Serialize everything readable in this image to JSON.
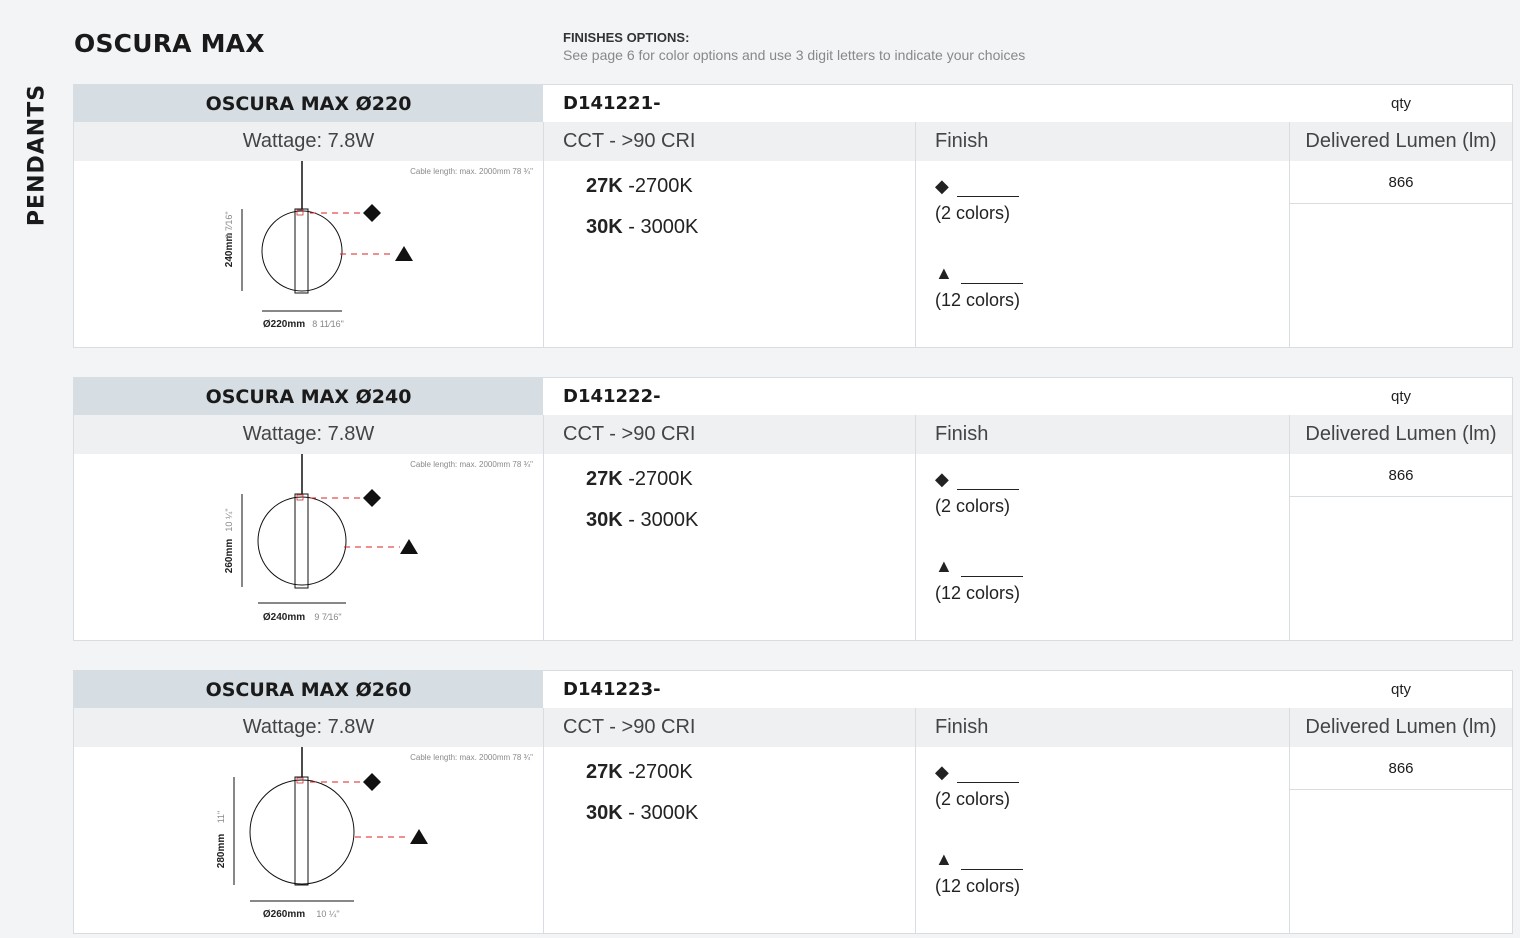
{
  "side_label": "PENDANTS",
  "title": "OSCURA MAX",
  "finishes": {
    "title": "FINISHES OPTIONS:",
    "subtitle": "See page 6 for color options and use 3 digit letters to indicate your choices"
  },
  "products": [
    {
      "name": "OSCURA MAX Ø220",
      "code": "D141221-",
      "qty_label": "qty",
      "wattage": "Wattage: 7.8W",
      "cct_header": "CCT - >90 CRI",
      "finish_header": "Finish",
      "lumen_header": "Delivered Lumen (lm)",
      "cable_note": "Cable length: max. 2000mm 78 ¾\"",
      "height_dim": "240mm",
      "height_in": "9 7⁄16\"",
      "diameter_dim": "Ø220mm",
      "diameter_in": "8 11⁄16\"",
      "cct": [
        {
          "code": "27K",
          "value": " -2700K"
        },
        {
          "code": "30K",
          "value": " - 3000K"
        }
      ],
      "finish_diamond": "(2 colors)",
      "finish_triangle": "(12 colors)",
      "lumen": "866"
    },
    {
      "name": "OSCURA MAX Ø240",
      "code": "D141222-",
      "qty_label": "qty",
      "wattage": "Wattage: 7.8W",
      "cct_header": "CCT - >90 CRI",
      "finish_header": "Finish",
      "lumen_header": "Delivered Lumen (lm)",
      "cable_note": "Cable length: max. 2000mm 78 ¾\"",
      "height_dim": "260mm",
      "height_in": "10 ¼\"",
      "diameter_dim": "Ø240mm",
      "diameter_in": "9 7⁄16\"",
      "cct": [
        {
          "code": "27K",
          "value": " -2700K"
        },
        {
          "code": "30K",
          "value": " - 3000K"
        }
      ],
      "finish_diamond": "(2 colors)",
      "finish_triangle": "(12 colors)",
      "lumen": "866"
    },
    {
      "name": "OSCURA MAX Ø260",
      "code": "D141223-",
      "qty_label": "qty",
      "wattage": "Wattage: 7.8W",
      "cct_header": "CCT - >90 CRI",
      "finish_header": "Finish",
      "lumen_header": "Delivered Lumen (lm)",
      "cable_note": "Cable length: max. 2000mm 78 ¾\"",
      "height_dim": "280mm",
      "height_in": "11\"",
      "diameter_dim": "Ø260mm",
      "diameter_in": "10 ¼\"",
      "cct": [
        {
          "code": "27K",
          "value": " -2700K"
        },
        {
          "code": "30K",
          "value": " - 3000K"
        }
      ],
      "finish_diamond": "(2 colors)",
      "finish_triangle": "(12 colors)",
      "lumen": "866"
    }
  ]
}
